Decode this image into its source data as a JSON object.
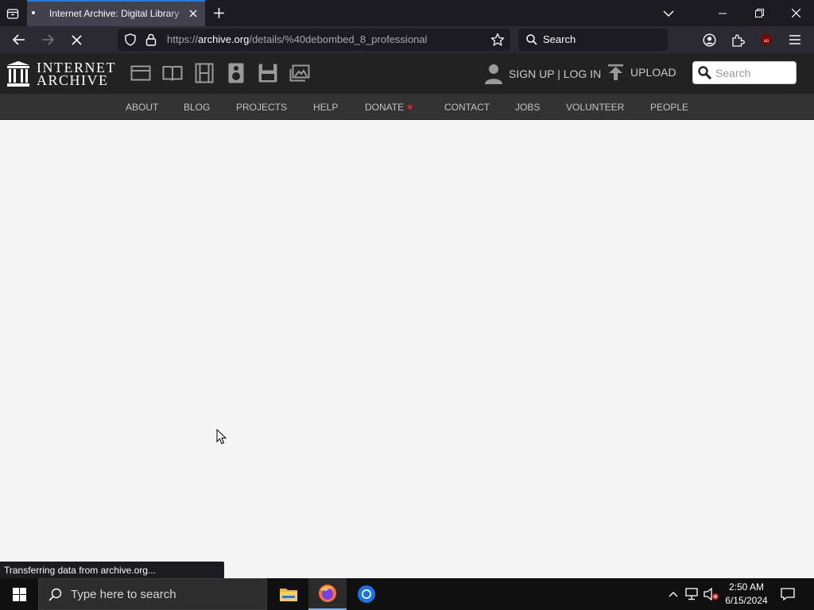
{
  "browser": {
    "tab": {
      "title": "Internet Archive: Digital Library"
    },
    "url": {
      "prefix": "https://",
      "host": "archive.org",
      "path": "/details/%40debombed_8_professional"
    },
    "search_placeholder": "Search",
    "status": "Transferring data from archive.org..."
  },
  "site": {
    "logo_line1": "INTERNET",
    "logo_line2": "ARCHIVE",
    "signup_label": "SIGN UP | LOG IN",
    "upload_label": "UPLOAD",
    "search_placeholder": "Search",
    "media_icons": [
      "video-icon",
      "texts-icon",
      "film-icon",
      "audio-icon",
      "software-icon",
      "images-icon"
    ],
    "nav": [
      {
        "label": "ABOUT"
      },
      {
        "label": "BLOG"
      },
      {
        "label": "PROJECTS"
      },
      {
        "label": "HELP"
      },
      {
        "label": "DONATE"
      },
      {
        "label": "CONTACT"
      },
      {
        "label": "JOBS"
      },
      {
        "label": "VOLUNTEER"
      },
      {
        "label": "PEOPLE"
      }
    ]
  },
  "taskbar": {
    "search_placeholder": "Type here to search",
    "time": "2:50 AM",
    "date": "6/15/2024"
  },
  "colors": {
    "accent": "#0a84ff",
    "header_bg": "#222222",
    "nav_bg": "#333333",
    "donate_heart": "#e0242b"
  }
}
